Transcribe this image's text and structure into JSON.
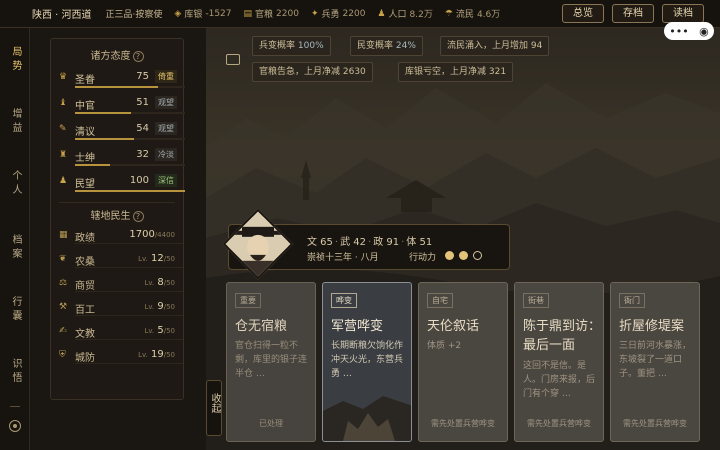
{
  "topbar": {
    "location": "陕西 · 河西道",
    "rank": "正三品·按察使",
    "stats": [
      {
        "icon": "coin-icon",
        "label": "库银",
        "value": "-1527"
      },
      {
        "icon": "grain-icon",
        "label": "官粮",
        "value": "2200"
      },
      {
        "icon": "soldier-icon",
        "label": "兵勇",
        "value": "2200"
      },
      {
        "icon": "people-icon",
        "label": "人口",
        "value": "8.2万"
      },
      {
        "icon": "refugee-icon",
        "label": "流民",
        "value": "4.6万"
      }
    ],
    "buttons": {
      "overview": "总览",
      "save": "存档",
      "load": "读档"
    }
  },
  "nav": {
    "items": [
      "局势",
      "增益",
      "个人",
      "档案",
      "行囊",
      "识悟"
    ],
    "active": "局势"
  },
  "factions": {
    "title": "诸方态度",
    "help": "?",
    "items": [
      {
        "icon": "crown-icon",
        "name": "圣眷",
        "value": "75",
        "tag": "倚重",
        "tag_style": "gold",
        "fill": 0.75
      },
      {
        "icon": "eunuch-icon",
        "name": "中官",
        "value": "51",
        "tag": "观望",
        "tag_style": "gray",
        "fill": 0.51
      },
      {
        "icon": "scholar-icon",
        "name": "清议",
        "value": "54",
        "tag": "观望",
        "tag_style": "gray",
        "fill": 0.54
      },
      {
        "icon": "gentry-icon",
        "name": "士绅",
        "value": "32",
        "tag": "冷淡",
        "tag_style": "gray",
        "fill": 0.32
      },
      {
        "icon": "people-icon",
        "name": "民望",
        "value": "100",
        "tag": "深信",
        "tag_style": "green",
        "fill": 1.0
      }
    ]
  },
  "livelihood": {
    "title": "辖地民生",
    "help": "?",
    "items": [
      {
        "icon": "governance-icon",
        "name": "政绩",
        "value": "1700",
        "max": "/4400"
      },
      {
        "icon": "farm-icon",
        "name": "农桑",
        "value": "12",
        "prefix": "Lv.",
        "max": "/50"
      },
      {
        "icon": "trade-icon",
        "name": "商贸",
        "value": "8",
        "prefix": "Lv.",
        "max": "/50"
      },
      {
        "icon": "craft-icon",
        "name": "百工",
        "value": "9",
        "prefix": "Lv.",
        "max": "/50"
      },
      {
        "icon": "education-icon",
        "name": "文教",
        "value": "5",
        "prefix": "Lv.",
        "max": "/50"
      },
      {
        "icon": "defense-icon",
        "name": "城防",
        "value": "19",
        "prefix": "Lv.",
        "max": "/50"
      }
    ]
  },
  "chips": {
    "c1_label": "兵变概率",
    "c1_value": "100%",
    "c2_label": "民变概率",
    "c2_value": "24%",
    "c3": "流民涌入，上月增加 94",
    "c4": "官粮告急，上月净减 2630",
    "c5": "库银亏空，上月净减 321"
  },
  "character": {
    "wen": "文 65",
    "wu": "武 42",
    "zheng": "政 91",
    "ti": "体 51",
    "date": "崇祯十三年 · 八月",
    "action_label": "行动力",
    "action_points": 2,
    "action_max": 3
  },
  "cards": [
    {
      "tag": "重要",
      "title": "仓无宿粮",
      "desc": "官仓扫得一粒不剩，库里的银子连半仓 …",
      "foot": "已处理",
      "style": "done"
    },
    {
      "tag": "哗变",
      "title": "军营哗变",
      "desc": "长期断粮欠饷化作冲天火光，东营兵勇 …",
      "foot": "",
      "style": "hot"
    },
    {
      "tag": "自宅",
      "title": "天伦叙话",
      "desc": "体质 +2",
      "foot": "需先处置兵营哗变",
      "style": "normal"
    },
    {
      "tag": "街巷",
      "title": "陈于鼎到访：最后一面",
      "desc": "这回不是信。是人。门房来报，后门有个穿 …",
      "foot": "需先处置兵营哗变",
      "style": "normal"
    },
    {
      "tag": "衙门",
      "title": "折屋修堤案",
      "desc": "三日前河水暴涨，东坡裂了一道口子。董把 …",
      "foot": "需先处置兵营哗变",
      "style": "normal"
    }
  ],
  "collapse_label": "收起"
}
